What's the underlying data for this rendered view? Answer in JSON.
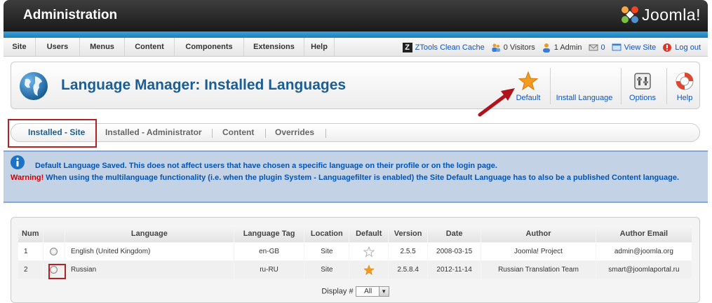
{
  "header": {
    "title": "Administration",
    "logo_text": "Joomla!"
  },
  "menu": [
    "Site",
    "Users",
    "Menus",
    "Content",
    "Components",
    "Extensions",
    "Help"
  ],
  "status": {
    "ztools": "ZTools Clean Cache",
    "visitors": "0 Visitors",
    "admins": "1 Admin",
    "messages": "0",
    "view_site": "View Site",
    "logout": "Log out"
  },
  "toolbar": {
    "page_title": "Language Manager: Installed Languages",
    "default_label": "Default",
    "install_label": "Install Language",
    "options_label": "Options",
    "help_label": "Help"
  },
  "subtabs": [
    "Installed - Site",
    "Installed - Administrator",
    "Content",
    "Overrides"
  ],
  "messages": {
    "info": "Default Language Saved. This does not affect users that have chosen a specific language on their profile or on the login page.",
    "warning_label": "Warning!",
    "warning": " When using the multilanguage functionality (i.e. when the plugin System - Languagefilter is enabled) the Site Default Language has to also be a published Content language."
  },
  "table": {
    "headers": [
      "Num",
      "",
      "Language",
      "Language Tag",
      "Location",
      "Default",
      "Version",
      "Date",
      "Author",
      "Author Email"
    ],
    "rows": [
      {
        "num": "1",
        "language": "English (United Kingdom)",
        "tag": "en-GB",
        "location": "Site",
        "default": false,
        "version": "2.5.5",
        "date": "2008-03-15",
        "author": "Joomla! Project",
        "email": "admin@joomla.org"
      },
      {
        "num": "2",
        "language": "Russian",
        "tag": "ru-RU",
        "location": "Site",
        "default": true,
        "version": "2.5.8.4",
        "date": "2012-11-14",
        "author": "Russian Translation Team",
        "email": "smart@joomlaportal.ru"
      }
    ],
    "display_label": "Display #",
    "display_value": "All"
  },
  "colors": {
    "accent": "#1a5e96",
    "link": "#0b55c4",
    "warning": "#cc0000",
    "message_bg": "#c3d2e5"
  }
}
